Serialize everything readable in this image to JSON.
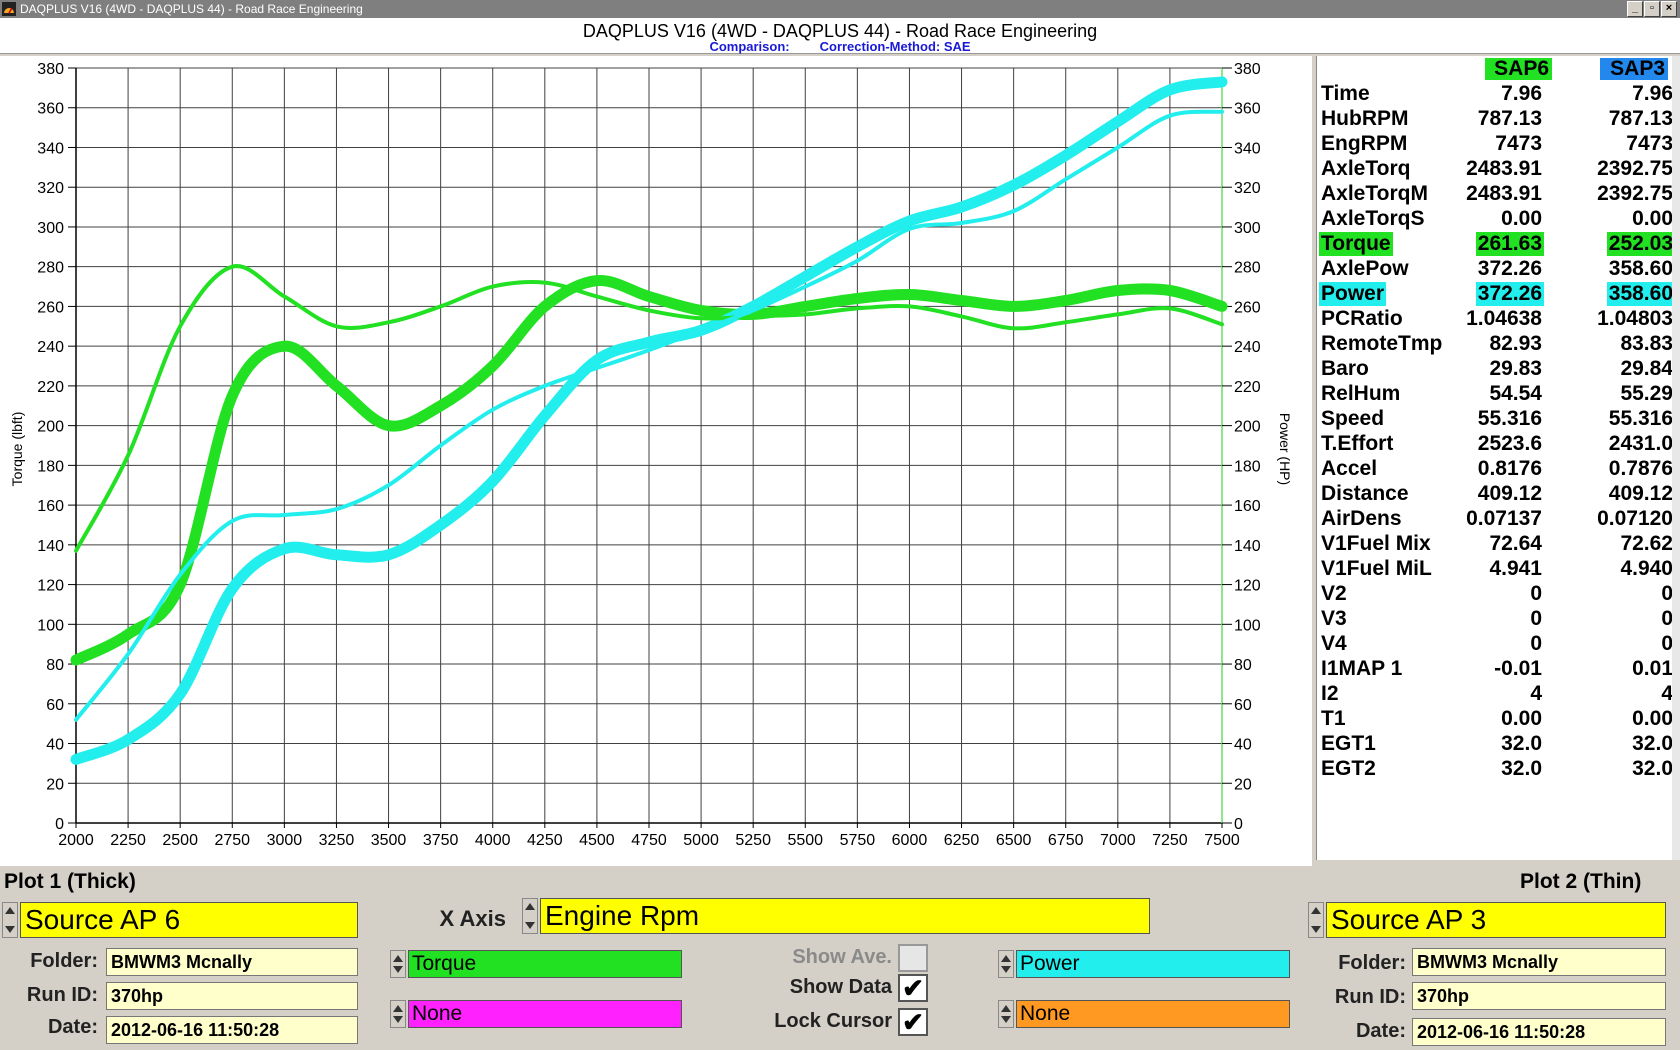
{
  "window": {
    "title": "DAQPLUS V16 (4WD - DAQPLUS 44) - Road Race Engineering",
    "header_title": "DAQPLUS V16 (4WD - DAQPLUS 44) - Road Race Engineering",
    "comparison_label": "Comparison:",
    "correction_label": "Correction-Method: SAE"
  },
  "colors": {
    "green": "#22e022",
    "cyan": "#22eeee",
    "yellow": "#ffff00",
    "magenta": "#ff22ff",
    "orange": "#ff9922",
    "blue_header": "#2288ee"
  },
  "chart_data": {
    "type": "line",
    "xlabel": "",
    "ylabel_left": "Torque (lbft)",
    "ylabel_right": "Power (HP)",
    "xlim": [
      2000,
      7500
    ],
    "ylim": [
      0,
      380
    ],
    "x_ticks": [
      2000,
      2250,
      2500,
      2750,
      3000,
      3250,
      3500,
      3750,
      4000,
      4250,
      4500,
      4750,
      5000,
      5250,
      5500,
      5750,
      6000,
      6250,
      6500,
      6750,
      7000,
      7250,
      7500
    ],
    "y_ticks": [
      0,
      20,
      40,
      60,
      80,
      100,
      120,
      140,
      160,
      180,
      200,
      220,
      240,
      260,
      280,
      300,
      320,
      340,
      360,
      380
    ],
    "grid": true,
    "x": [
      2000,
      2250,
      2500,
      2750,
      3000,
      3250,
      3500,
      3750,
      4000,
      4250,
      4500,
      4750,
      5000,
      5250,
      5500,
      5750,
      6000,
      6250,
      6500,
      6750,
      7000,
      7250,
      7500
    ],
    "series": [
      {
        "name": "Torque",
        "source": "Source AP 6",
        "color": "#22e022",
        "width": "thick",
        "values": [
          82,
          95,
          120,
          215,
          240,
          220,
          200,
          210,
          230,
          260,
          273,
          265,
          258,
          256,
          260,
          264,
          266,
          263,
          260,
          263,
          268,
          268,
          260
        ]
      },
      {
        "name": "Power",
        "source": "Source AP 6",
        "color": "#22eeee",
        "width": "thick",
        "values": [
          32,
          42,
          65,
          118,
          138,
          135,
          135,
          150,
          172,
          205,
          233,
          242,
          248,
          260,
          275,
          290,
          303,
          310,
          321,
          336,
          353,
          369,
          373
        ]
      },
      {
        "name": "Torque",
        "source": "Source AP 3",
        "color": "#22e022",
        "width": "thin",
        "values": [
          137,
          185,
          250,
          280,
          265,
          250,
          252,
          260,
          270,
          272,
          265,
          258,
          254,
          255,
          256,
          259,
          260,
          255,
          249,
          252,
          256,
          259,
          251
        ]
      },
      {
        "name": "Power",
        "source": "Source AP 3",
        "color": "#22eeee",
        "width": "thin",
        "values": [
          52,
          85,
          125,
          152,
          155,
          158,
          170,
          190,
          208,
          220,
          229,
          238,
          248,
          258,
          270,
          283,
          299,
          302,
          308,
          324,
          340,
          356,
          358
        ]
      }
    ]
  },
  "data_panel": {
    "col1_header": "SAP6",
    "col2_header": "SAP3",
    "rows": [
      {
        "label": "Time",
        "v1": "7.96",
        "v2": "7.96"
      },
      {
        "label": "HubRPM",
        "v1": "787.13",
        "v2": "787.13"
      },
      {
        "label": "EngRPM",
        "v1": "7473",
        "v2": "7473"
      },
      {
        "label": "AxleTorq",
        "v1": "2483.91",
        "v2": "2392.75"
      },
      {
        "label": "AxleTorqM",
        "v1": "2483.91",
        "v2": "2392.75"
      },
      {
        "label": "AxleTorqS",
        "v1": "0.00",
        "v2": "0.00"
      },
      {
        "label": "Torque",
        "v1": "261.63",
        "v2": "252.03",
        "highlight": "#22e022"
      },
      {
        "label": "AxlePow",
        "v1": "372.26",
        "v2": "358.60"
      },
      {
        "label": "Power",
        "v1": "372.26",
        "v2": "358.60",
        "highlight": "#22eeee"
      },
      {
        "label": "PCRatio",
        "v1": "1.04638",
        "v2": "1.04803"
      },
      {
        "label": "RemoteTmp",
        "v1": "82.93",
        "v2": "83.83"
      },
      {
        "label": "Baro",
        "v1": "29.83",
        "v2": "29.84"
      },
      {
        "label": "RelHum",
        "v1": "54.54",
        "v2": "55.29"
      },
      {
        "label": "Speed",
        "v1": "55.316",
        "v2": "55.316"
      },
      {
        "label": "T.Effort",
        "v1": "2523.6",
        "v2": "2431.0"
      },
      {
        "label": "Accel",
        "v1": "0.8176",
        "v2": "0.7876"
      },
      {
        "label": "Distance",
        "v1": "409.12",
        "v2": "409.12"
      },
      {
        "label": "AirDens",
        "v1": "0.07137",
        "v2": "0.07120"
      },
      {
        "label": "V1Fuel Mix",
        "v1": "72.64",
        "v2": "72.62"
      },
      {
        "label": "V1Fuel MiL",
        "v1": "4.941",
        "v2": "4.940"
      },
      {
        "label": "V2",
        "v1": "0",
        "v2": "0"
      },
      {
        "label": "V3",
        "v1": "0",
        "v2": "0"
      },
      {
        "label": "V4",
        "v1": "0",
        "v2": "0"
      },
      {
        "label": "I1MAP 1",
        "v1": "-0.01",
        "v2": "0.01"
      },
      {
        "label": "I2",
        "v1": "4",
        "v2": "4"
      },
      {
        "label": "T1",
        "v1": "0.00",
        "v2": "0.00"
      },
      {
        "label": "EGT1",
        "v1": "32.0",
        "v2": "32.0"
      },
      {
        "label": "EGT2",
        "v1": "32.0",
        "v2": "32.0"
      }
    ]
  },
  "plot1": {
    "title": "Plot 1 (Thick)",
    "source": "Source AP 6",
    "folder_label": "Folder:",
    "folder": "BMWM3 Mcnally",
    "runid_label": "Run ID:",
    "runid": "370hp",
    "date_label": "Date:",
    "date": "2012-06-16 11:50:28"
  },
  "plot2": {
    "title": "Plot 2 (Thin)",
    "source": "Source AP 3",
    "folder_label": "Folder:",
    "folder": "BMWM3 Mcnally",
    "runid_label": "Run ID:",
    "runid": "370hp",
    "date_label": "Date:",
    "date": "2012-06-16 11:50:28"
  },
  "xaxis": {
    "label": "X Axis",
    "value": "Engine Rpm"
  },
  "channels": {
    "left1": "Torque",
    "left2": "None",
    "right1": "Power",
    "right2": "None"
  },
  "options": {
    "show_ave": "Show Ave.",
    "show_data": "Show Data",
    "lock_cursor": "Lock Cursor",
    "show_ave_checked": false,
    "show_data_checked": true,
    "lock_cursor_checked": true
  }
}
